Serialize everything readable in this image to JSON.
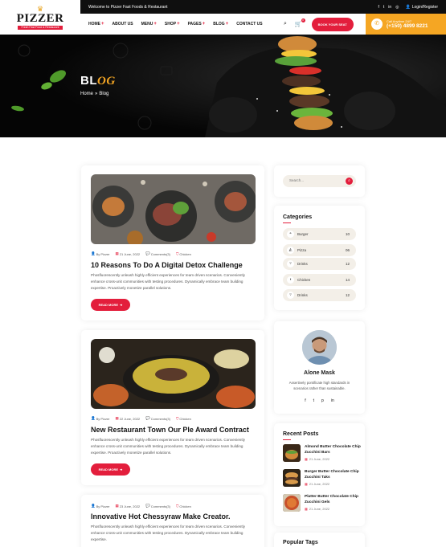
{
  "brand": {
    "name": "PIZZER",
    "tagline": "Fresh Fast Food & Restaurant"
  },
  "topbar": {
    "welcome": "Welcome to Pizzer Fast Foods & Restaurant",
    "login": "Login/Register",
    "socials": [
      "facebook-icon",
      "twitter-icon",
      "linkedin-icon",
      "instagram-icon"
    ]
  },
  "nav": {
    "items": [
      {
        "label": "HOME",
        "dropdown": true
      },
      {
        "label": "ABOUT US",
        "dropdown": false
      },
      {
        "label": "MENU",
        "dropdown": true
      },
      {
        "label": "SHOP",
        "dropdown": true
      },
      {
        "label": "PAGES",
        "dropdown": true
      },
      {
        "label": "BLOG",
        "dropdown": true
      },
      {
        "label": "CONTACT US",
        "dropdown": false
      }
    ],
    "cart_count": "0",
    "book_label": "BOOK YOUR SEAT"
  },
  "call": {
    "label": "Call Anytime 24/7",
    "number": "(+150) 4899 8221"
  },
  "hero": {
    "title_main": "BL",
    "title_accent": "OG",
    "breadcrumb_home": "Home",
    "breadcrumb_sep": "»",
    "breadcrumb_current": "Blog"
  },
  "posts": [
    {
      "author": "By Pizzer",
      "date": "21 June, 2022",
      "comments": "Comments(3)",
      "category": "Chicken",
      "title": "10 Reasons To Do A Digital Detox Challenge",
      "excerpt": "Phosfluorescently unleash highly efficient experiences for team driven scenarios. Conveniently enhance cross-unit communities with testing procedures. Dynamically embrace team building expertise. Proactively monetize parallel solutions.",
      "button": "READ MORE"
    },
    {
      "author": "By Pizzer",
      "date": "22 June, 2022",
      "comments": "Comments(3)",
      "category": "Chicken",
      "title": "New Restaurant Town Our Ple Award Contract",
      "excerpt": "Phosfluorescently unleash highly efficient experiences for team driven scenarios. Conveniently enhance cross-unit communities with testing procedures. Dynamically embrace team building expertise. Proactively monetize parallel solutions.",
      "button": "READ MORE"
    },
    {
      "author": "By Pizzer",
      "date": "23 June, 2022",
      "comments": "Comments(3)",
      "category": "Chicken",
      "title": "Innovative Hot Chessyraw Make Creator.",
      "excerpt": "Phosfluorescently unleash highly efficient experiences for team driven scenarios. Conveniently enhance cross-unit communities with testing procedures. Dynamically embrace team building expertise."
    }
  ],
  "sidebar": {
    "search_placeholder": "Search...",
    "categories_title": "Categories",
    "categories": [
      {
        "label": "Burger",
        "count": "10"
      },
      {
        "label": "Pizza",
        "count": "06"
      },
      {
        "label": "Drinks",
        "count": "12"
      },
      {
        "label": "Chicken",
        "count": "14"
      },
      {
        "label": "Drinks",
        "count": "12"
      }
    ],
    "author": {
      "name": "Alone Mask",
      "bio": "Assertively pontificate high standards in scenarios rather than sustainable."
    },
    "recent_title": "Recent Posts",
    "recent": [
      {
        "title": "Almond Butter Chocolate Chip Zucchini Bars",
        "date": "21 June, 2022"
      },
      {
        "title": "Burger Butter Chocolate Chip Zucchini Taks",
        "date": "21 June, 2022"
      },
      {
        "title": "Platter Butter Chocolate Chip Zucchini Gels",
        "date": "21 June, 2022"
      }
    ],
    "tags_title": "Popular Tags"
  },
  "colors": {
    "accent": "#e31e3c",
    "yellow": "#f5a623",
    "dark": "#0f0f0f"
  }
}
